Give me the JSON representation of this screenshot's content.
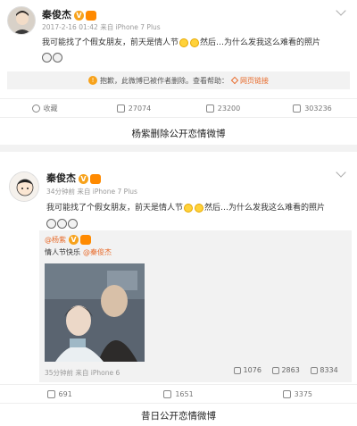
{
  "post1": {
    "username": "秦俊杰",
    "meta": "2017-2-16 01:42 来自 iPhone 7 Plus",
    "text": "我可能找了个假女朋友，前天是情人节",
    "text2": "然后…为什么发我这么难看的照片",
    "notice": "抱歉，此微博已被作者删除。查看帮助：",
    "notice_link": "网页链接",
    "actions": {
      "fav": "收藏",
      "repost": "27074",
      "comment": "23200",
      "like": "303236"
    }
  },
  "caption1": "杨紫删除公开恋情微博",
  "post2": {
    "username": "秦俊杰",
    "meta": "34分钟前 来自 iPhone 7 Plus",
    "text": "我可能找了个假女朋友，前天是情人节",
    "text2": "然后…为什么发我这么难看的照片",
    "repost_user": "@杨紫",
    "repost_text": "情人节快乐",
    "repost_mention": "@秦俊杰",
    "repost_meta": "35分钟前 来自 iPhone 6",
    "repost_counts": {
      "repost": "1076",
      "comment": "2863",
      "like": "8334"
    },
    "actions": {
      "repost": "691",
      "comment": "1651",
      "like": "3375"
    }
  },
  "caption2": "昔日公开恋情微博",
  "colors": {
    "accent": "#e86c2c",
    "badge": "#f7a21b"
  }
}
